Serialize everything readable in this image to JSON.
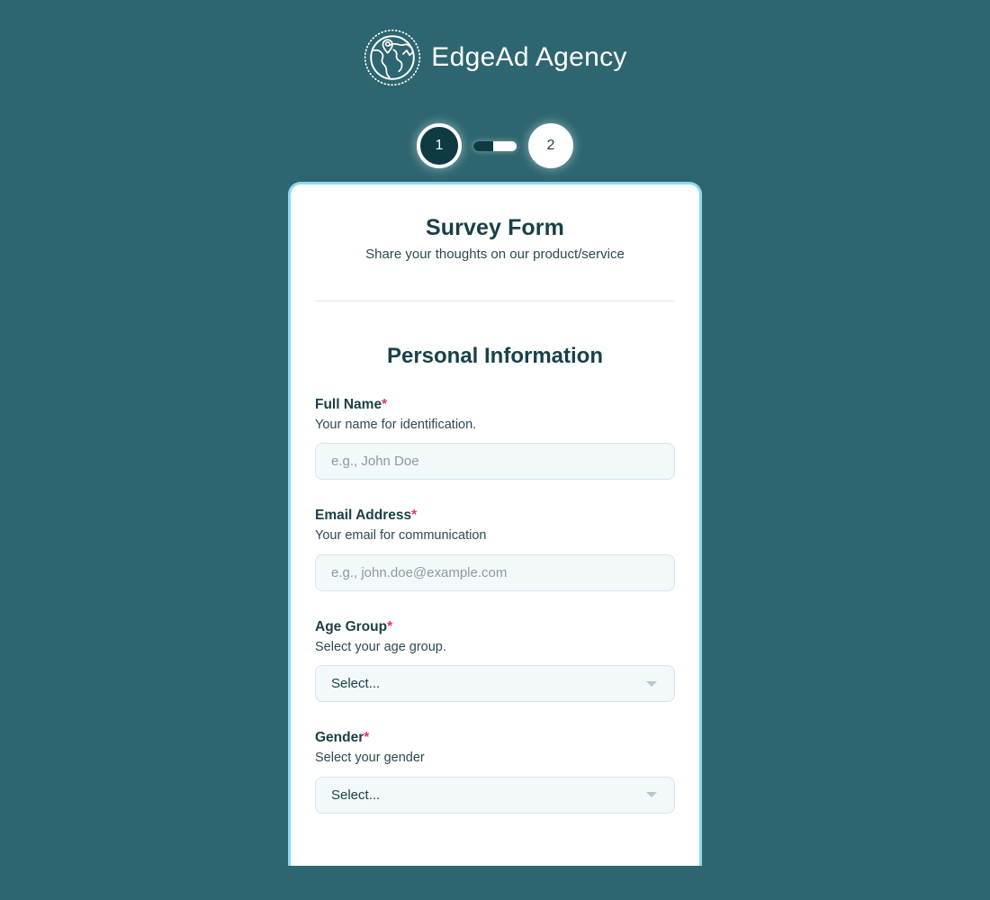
{
  "theme": {
    "page_background": "#2d6670",
    "card_border": "#8ed8ef",
    "accent_dark": "#0e3a43",
    "required_color": "#e0356b",
    "input_background": "#f3f8fa",
    "heading_color": "#1a3f47"
  },
  "brand": {
    "logo_icon": "globe-location-pin-icon",
    "name": "EdgeAd Agency"
  },
  "stepper": {
    "steps": [
      {
        "label": "1",
        "state": "active"
      },
      {
        "label": "2",
        "state": "inactive"
      }
    ],
    "progress_percent": 45
  },
  "form": {
    "title": "Survey Form",
    "subtitle": "Share your thoughts on our product/service",
    "section_title": "Personal Information",
    "required_marker": "*",
    "fields": [
      {
        "label": "Full Name",
        "required": true,
        "description": "Your name for identification.",
        "type": "text",
        "value": "",
        "placeholder": "e.g., John Doe"
      },
      {
        "label": "Email Address",
        "required": true,
        "description": "Your email for communication",
        "type": "email",
        "value": "",
        "placeholder": "e.g., john.doe@example.com"
      },
      {
        "label": "Age Group",
        "required": true,
        "description": "Select your age group.",
        "type": "select",
        "value": "Select...",
        "caret_icon": "chevron-down-icon"
      },
      {
        "label": "Gender",
        "required": true,
        "description": "Select your gender",
        "type": "select",
        "value": "Select...",
        "caret_icon": "chevron-down-icon"
      }
    ]
  }
}
